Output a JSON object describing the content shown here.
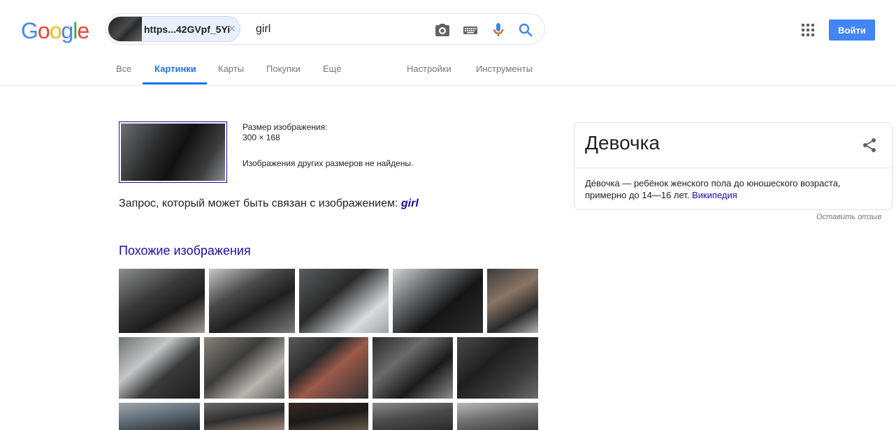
{
  "header": {
    "logo": [
      "G",
      "o",
      "o",
      "g",
      "l",
      "e"
    ],
    "logo_colors": [
      "#4285f4",
      "#ea4335",
      "#fbbc05",
      "#4285f4",
      "#34a853",
      "#ea4335"
    ],
    "image_chip_text": "https...42GVpf_5Yi",
    "chip_close": "×",
    "query": "girl",
    "signin_label": "Войти"
  },
  "tabs": [
    {
      "label": "Все"
    },
    {
      "label": "Картинки",
      "active": true
    },
    {
      "label": "Карты"
    },
    {
      "label": "Покупки"
    },
    {
      "label": "Ещё"
    },
    {
      "label": "Настройки"
    },
    {
      "label": "Инструменты"
    }
  ],
  "result": {
    "size_label": "Размер изображения:",
    "size_value": "300 × 168",
    "other_sizes": "Изображения других размеров не найдены.",
    "related_prefix": "Запрос, который может быть связан с изображением: ",
    "related_query": "girl",
    "similar_title": "Похожие изображения"
  },
  "knowledge_panel": {
    "title": "Девочка",
    "description": "Де́вочка — ребёнок женского пола до юношеского возраста, примерно до 14—16 лет.",
    "source_link": "Википедия",
    "feedback": "Оставить отзыв"
  },
  "colors": {
    "accent": "#1a73e8",
    "link": "#1a0dab",
    "signin": "#4285f4"
  },
  "icons": [
    "camera-icon",
    "keyboard-icon",
    "mic-icon",
    "search-icon",
    "apps-grid-icon",
    "share-icon",
    "close-icon"
  ]
}
